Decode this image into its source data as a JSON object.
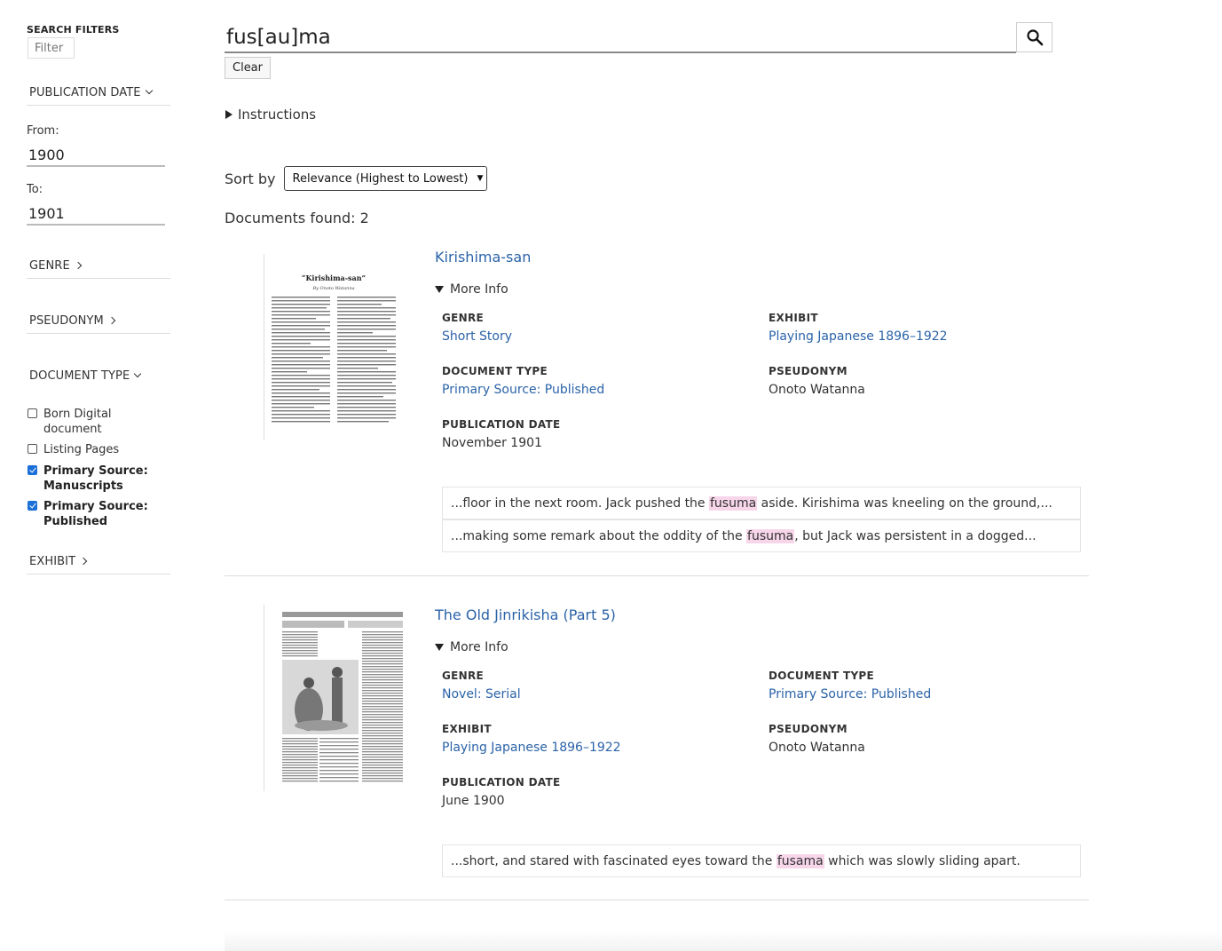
{
  "sidebar": {
    "title": "SEARCH FILTERS",
    "filter_placeholder": "Filter",
    "publication_date": {
      "label": "PUBLICATION DATE",
      "from_label": "From:",
      "from_value": "1900",
      "to_label": "To:",
      "to_value": "1901"
    },
    "genre_label": "GENRE",
    "pseudonym_label": "PSEUDONYM",
    "document_type": {
      "label": "DOCUMENT TYPE",
      "options": [
        {
          "label_line1": "Born Digital",
          "label_line2": "document",
          "checked": false
        },
        {
          "label_line1": "Listing Pages",
          "label_line2": "",
          "checked": false
        },
        {
          "label_line1": "Primary Source:",
          "label_line2": "Manuscripts",
          "checked": true
        },
        {
          "label_line1": "Primary Source:",
          "label_line2": "Published",
          "checked": true
        }
      ]
    },
    "exhibit_label": "EXHIBIT"
  },
  "search": {
    "query": "fus[au]ma",
    "clear_label": "Clear",
    "search_icon": "search-icon"
  },
  "instructions_label": "Instructions",
  "sort": {
    "label": "Sort by",
    "selected": "Relevance (Highest to Lowest)"
  },
  "docs_found": "Documents found: 2",
  "results": [
    {
      "title": "Kirishima-san",
      "more_info": "More Info",
      "thumb": {
        "heading": "“Kirishima-san”",
        "byline": "By Onoto Watanna"
      },
      "fields": {
        "genre_label": "GENRE",
        "genre": "Short Story",
        "exhibit_label": "EXHIBIT",
        "exhibit": "Playing Japanese 1896–1922",
        "doctype_label": "DOCUMENT TYPE",
        "doctype": "Primary Source: Published",
        "pseudonym_label": "PSEUDONYM",
        "pseudonym": "Onoto Watanna",
        "pubdate_label": "PUBLICATION DATE",
        "pubdate": "November 1901"
      },
      "snippets": [
        {
          "before": "...floor in the next room. Jack pushed the ",
          "match": "fusuma",
          "after": " aside. Kirishima was kneeling on the ground,..."
        },
        {
          "before": "...making some remark about the oddity of the ",
          "match": "fusuma",
          "after": ", but Jack was persistent in a dogged..."
        }
      ]
    },
    {
      "title": "The Old Jinrikisha (Part 5)",
      "more_info": "More Info",
      "fields": {
        "genre_label": "GENRE",
        "genre": "Novel: Serial",
        "doctype_label": "DOCUMENT TYPE",
        "doctype": "Primary Source: Published",
        "exhibit_label": "EXHIBIT",
        "exhibit": "Playing Japanese 1896–1922",
        "pseudonym_label": "PSEUDONYM",
        "pseudonym": "Onoto Watanna",
        "pubdate_label": "PUBLICATION DATE",
        "pubdate": "June 1900"
      },
      "snippets": [
        {
          "before": "...short, and stared with fascinated eyes toward the ",
          "match": "fusama",
          "after": " which was slowly sliding apart."
        }
      ]
    }
  ]
}
